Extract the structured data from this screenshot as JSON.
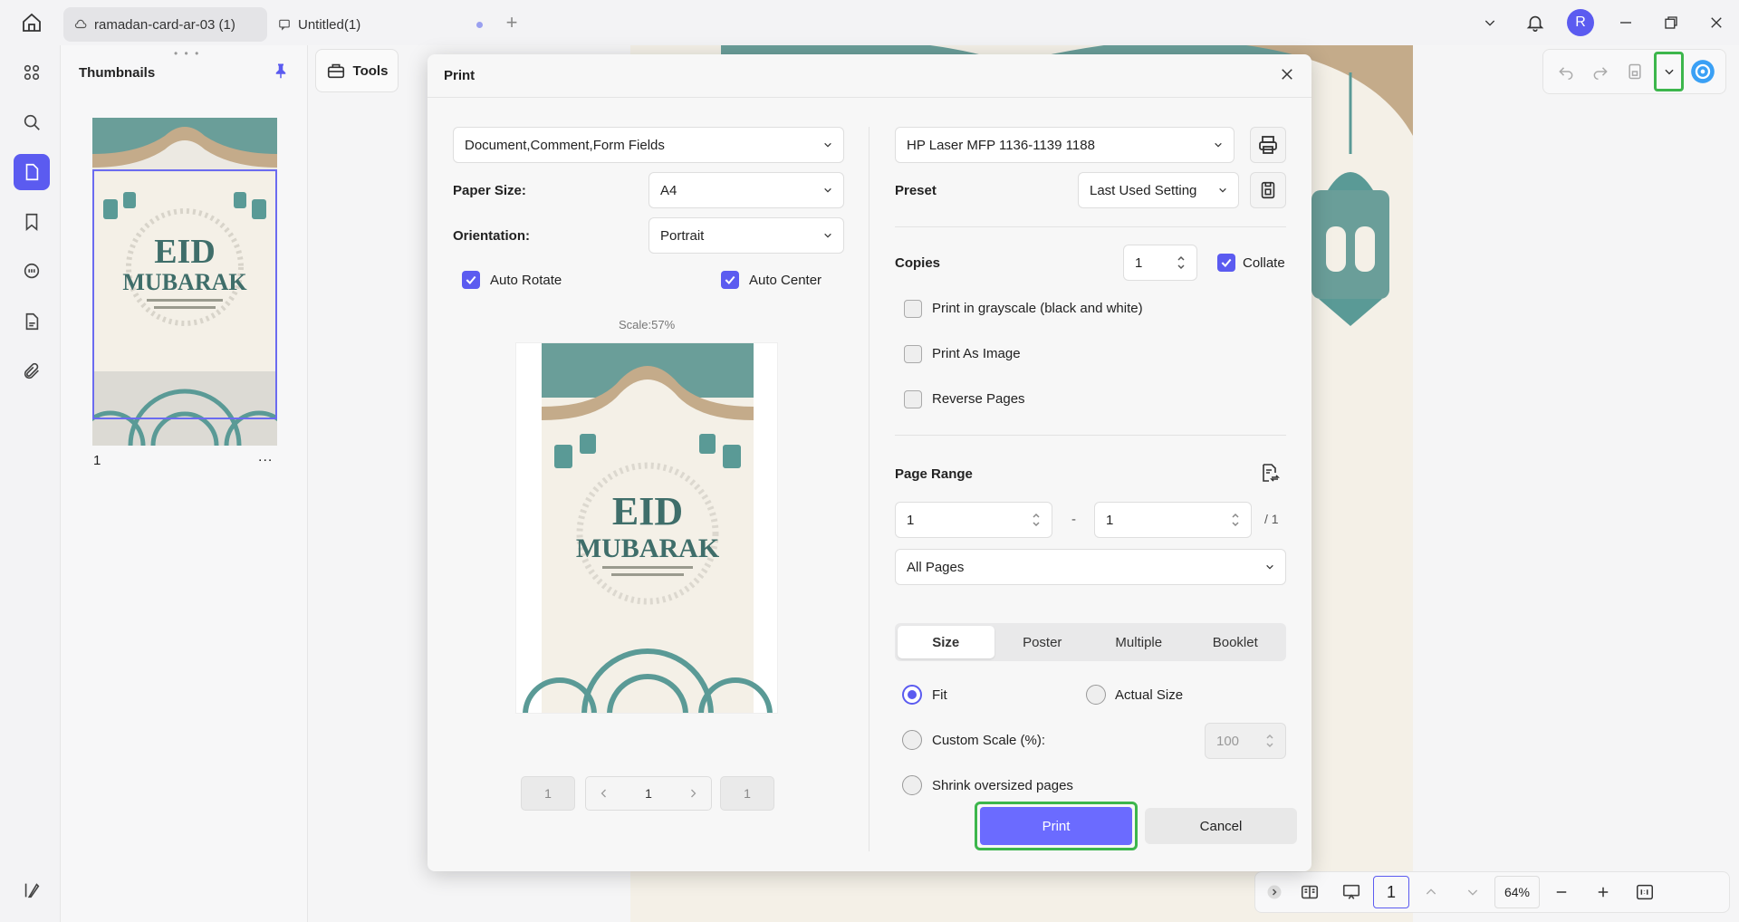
{
  "titlebar": {
    "tabs": [
      {
        "label": "ramadan-card-ar-03 (1)"
      },
      {
        "label": "Untitled(1)"
      }
    ],
    "avatar_initial": "R"
  },
  "thumbnails": {
    "title": "Thumbnails",
    "page_number": "1",
    "more": "...",
    "card_title_line1": "EID",
    "card_title_line2": "MUBARAK"
  },
  "tools": {
    "label": "Tools"
  },
  "dialog": {
    "title": "Print",
    "content_select": "Document,Comment,Form Fields",
    "paper_size_label": "Paper Size:",
    "paper_size_value": "A4",
    "orientation_label": "Orientation:",
    "orientation_value": "Portrait",
    "auto_rotate": "Auto Rotate",
    "auto_center": "Auto Center",
    "scale_text": "Scale:57%",
    "preview_title_line1": "EID",
    "preview_title_line2": "MUBARAK",
    "nav_first": "1",
    "nav_current": "1",
    "nav_last": "1",
    "printer_value": "HP Laser MFP 1136-1139 1188",
    "preset_label": "Preset",
    "preset_value": "Last Used Setting",
    "copies_label": "Copies",
    "copies_value": "1",
    "collate": "Collate",
    "grayscale": "Print in grayscale (black and white)",
    "print_as_image": "Print As Image",
    "reverse_pages": "Reverse Pages",
    "page_range_label": "Page Range",
    "range_from": "1",
    "range_sep": "-",
    "range_to": "1",
    "range_total": "/ 1",
    "pages_select": "All Pages",
    "tabs": [
      "Size",
      "Poster",
      "Multiple",
      "Booklet"
    ],
    "fit": "Fit",
    "actual_size": "Actual Size",
    "custom_scale": "Custom Scale (%):",
    "custom_scale_value": "100",
    "shrink": "Shrink oversized pages",
    "print_button": "Print",
    "cancel_button": "Cancel"
  },
  "bottom_bar": {
    "page_value": "1",
    "zoom": "64%"
  },
  "colors": {
    "accent": "#5b5bf0",
    "highlight": "#3cb64c",
    "teal": "#5a9a96",
    "cream": "#f4f0e7"
  }
}
